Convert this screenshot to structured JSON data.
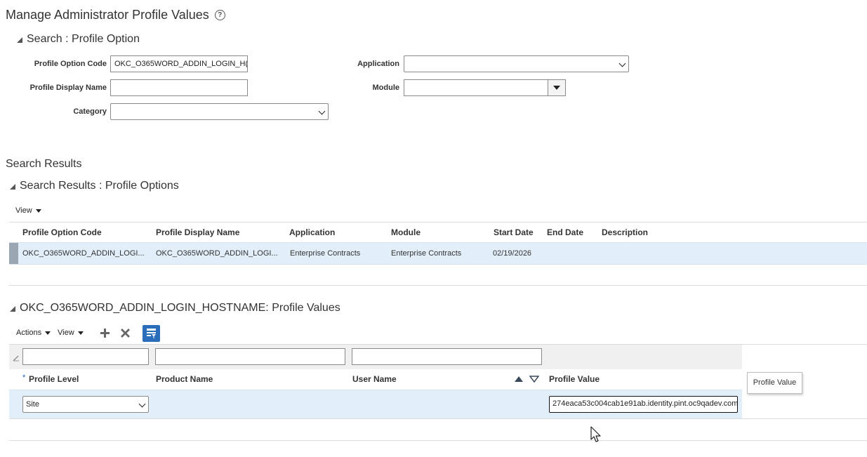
{
  "page": {
    "title": "Manage Administrator Profile Values"
  },
  "search": {
    "title": "Search : Profile Option",
    "profile_option_code_label": "Profile Option Code",
    "profile_option_code_value": "OKC_O365WORD_ADDIN_LOGIN_H(",
    "profile_display_name_label": "Profile Display Name",
    "profile_display_name_value": "",
    "category_label": "Category",
    "category_value": "",
    "application_label": "Application",
    "application_value": "",
    "module_label": "Module",
    "module_value": ""
  },
  "results": {
    "heading": "Search Results",
    "title": "Search Results : Profile Options",
    "view_label": "View",
    "columns": [
      "Profile Option Code",
      "Profile Display Name",
      "Application",
      "Module",
      "Start Date",
      "End Date",
      "Description"
    ],
    "row": {
      "code": "OKC_O365WORD_ADDIN_LOGI...",
      "display_name": "OKC_O365WORD_ADDIN_LOGI...",
      "application": "Enterprise Contracts",
      "module": "Enterprise Contracts",
      "start_date": "02/19/2026",
      "end_date": "",
      "description": ""
    }
  },
  "values": {
    "title": "OKC_O365WORD_ADDIN_LOGIN_HOSTNAME: Profile Values",
    "actions_label": "Actions",
    "view_label": "View",
    "required_mark": "*",
    "columns": [
      "Profile Level",
      "Product Name",
      "User Name",
      "Profile Value"
    ],
    "row": {
      "profile_level": "Site",
      "product_name": "",
      "user_name": "",
      "profile_value": "274eaca53c004cab1e91ab.identity.pint.oc9qadev.com"
    },
    "tooltip": "Profile Value"
  },
  "icons": [
    "help-icon",
    "collapse-icon",
    "add-icon",
    "delete-icon",
    "query-by-example-icon",
    "sort-ascending-icon",
    "sort-descending-icon",
    "edit-icon",
    "mouse-cursor-icon"
  ],
  "colors": {
    "selected_row": "#e2eef9",
    "accent_button": "#2a6ebb"
  }
}
